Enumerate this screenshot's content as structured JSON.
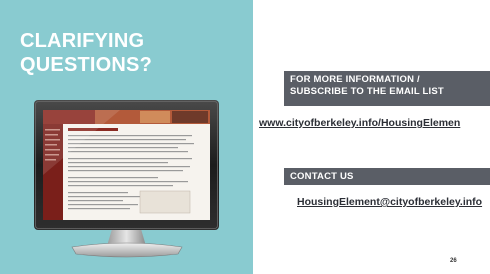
{
  "slide": {
    "title_lines": [
      "CLARIFYING",
      "QUESTIONS?"
    ],
    "page_number": "26",
    "colors": {
      "panel": "#89cbd0",
      "banner": "#5a5e66",
      "title_text": "#ffffff"
    }
  },
  "more_info": {
    "heading_lines": [
      "FOR MORE INFORMATION /",
      "SUBSCRIBE TO THE EMAIL LIST"
    ],
    "link_text": "www.cityofberkeley.info/HousingElemen"
  },
  "contact": {
    "heading": "CONTACT US",
    "email_text": "HousingElement@cityofberkeley.info"
  },
  "illustration": {
    "icon": "desktop-monitor-icon"
  }
}
